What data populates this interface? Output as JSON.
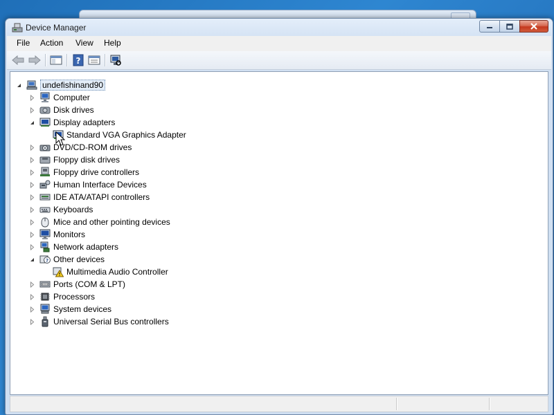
{
  "window": {
    "title": "Device Manager"
  },
  "menu": [
    "File",
    "Action",
    "View",
    "Help"
  ],
  "toolbar": {
    "buttons": [
      "back-arrow-icon",
      "forward-arrow-icon",
      "show-hide-console-tree-icon",
      "help-icon",
      "properties-icon",
      "scan-hardware-icon"
    ]
  },
  "tree": {
    "root": "undefishinand90",
    "nodes": [
      {
        "label": "Computer",
        "expanded": false,
        "icon": "computer-icon"
      },
      {
        "label": "Disk drives",
        "expanded": false,
        "icon": "disk-drive-icon"
      },
      {
        "label": "Display adapters",
        "expanded": true,
        "icon": "display-adapter-icon",
        "children": [
          {
            "label": "Standard VGA Graphics Adapter",
            "icon": "display-adapter-icon"
          }
        ]
      },
      {
        "label": "DVD/CD-ROM drives",
        "expanded": false,
        "icon": "dvd-drive-icon"
      },
      {
        "label": "Floppy disk drives",
        "expanded": false,
        "icon": "floppy-disk-icon"
      },
      {
        "label": "Floppy drive controllers",
        "expanded": false,
        "icon": "floppy-controller-icon"
      },
      {
        "label": "Human Interface Devices",
        "expanded": false,
        "icon": "hid-icon"
      },
      {
        "label": "IDE ATA/ATAPI controllers",
        "expanded": false,
        "icon": "ide-controller-icon"
      },
      {
        "label": "Keyboards",
        "expanded": false,
        "icon": "keyboard-icon"
      },
      {
        "label": "Mice and other pointing devices",
        "expanded": false,
        "icon": "mouse-icon"
      },
      {
        "label": "Monitors",
        "expanded": false,
        "icon": "monitor-icon"
      },
      {
        "label": "Network adapters",
        "expanded": false,
        "icon": "network-adapter-icon"
      },
      {
        "label": "Other devices",
        "expanded": true,
        "icon": "other-devices-icon",
        "children": [
          {
            "label": "Multimedia Audio Controller",
            "icon": "warning-device-icon"
          }
        ]
      },
      {
        "label": "Ports (COM & LPT)",
        "expanded": false,
        "icon": "port-icon"
      },
      {
        "label": "Processors",
        "expanded": false,
        "icon": "processor-icon"
      },
      {
        "label": "System devices",
        "expanded": false,
        "icon": "system-device-icon"
      },
      {
        "label": "Universal Serial Bus controllers",
        "expanded": false,
        "icon": "usb-icon"
      }
    ]
  }
}
